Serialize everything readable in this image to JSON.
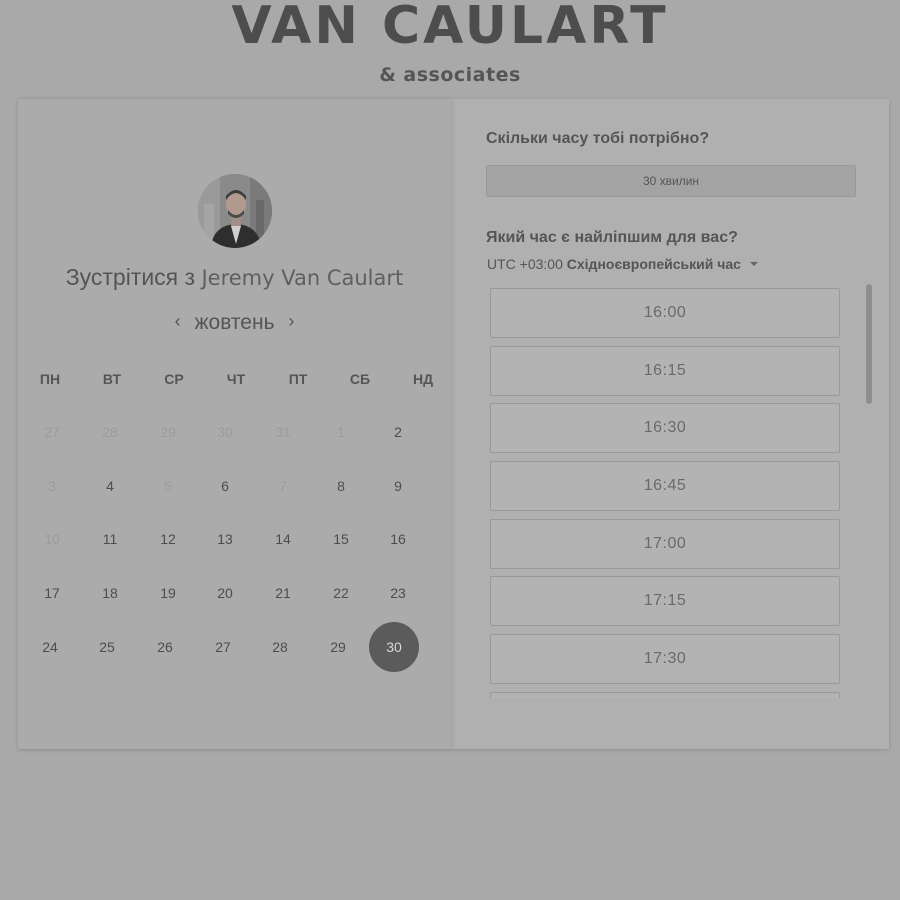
{
  "brand": {
    "name": "VAN CAULART",
    "subtitle": "& associates"
  },
  "calendar": {
    "title_prefix": "Зустрітися з",
    "host_name": "Jeremy Van Caulart",
    "month": "жовтень",
    "prev_icon": "‹",
    "next_icon": "›",
    "weekdays": [
      "ПН",
      "ВТ",
      "СР",
      "ЧТ",
      "ПТ",
      "СБ",
      "НД"
    ],
    "weeks": [
      [
        {
          "d": "27",
          "m": true
        },
        {
          "d": "28",
          "m": true
        },
        {
          "d": "29",
          "m": true
        },
        {
          "d": "30",
          "m": true
        },
        {
          "d": "31",
          "m": true
        },
        {
          "d": "1",
          "m": true
        },
        {
          "d": "2",
          "m": false
        }
      ],
      [
        {
          "d": "3",
          "m": true
        },
        {
          "d": "4",
          "m": false
        },
        {
          "d": "5",
          "m": true
        },
        {
          "d": "6",
          "m": false
        },
        {
          "d": "7",
          "m": true
        },
        {
          "d": "8",
          "m": false
        },
        {
          "d": "9",
          "m": false
        }
      ],
      [
        {
          "d": "10",
          "m": true
        },
        {
          "d": "11",
          "m": false
        },
        {
          "d": "12",
          "m": false
        },
        {
          "d": "13",
          "m": false
        },
        {
          "d": "14",
          "m": false
        },
        {
          "d": "15",
          "m": false
        },
        {
          "d": "16",
          "m": false
        }
      ],
      [
        {
          "d": "17",
          "m": false
        },
        {
          "d": "18",
          "m": false
        },
        {
          "d": "19",
          "m": false
        },
        {
          "d": "20",
          "m": false
        },
        {
          "d": "21",
          "m": false
        },
        {
          "d": "22",
          "m": false
        },
        {
          "d": "23",
          "m": false
        }
      ],
      [
        {
          "d": "24",
          "m": false
        },
        {
          "d": "25",
          "m": false
        },
        {
          "d": "26",
          "m": false
        },
        {
          "d": "27",
          "m": false
        },
        {
          "d": "28",
          "m": false
        },
        {
          "d": "29",
          "m": false
        },
        {
          "d": "30",
          "m": false
        }
      ]
    ],
    "selected_day": "30"
  },
  "booking": {
    "duration_question": "Скільки часу тобі потрібно?",
    "duration_value": "30 хвилин",
    "time_question": "Який час є найліпшим для вас?",
    "timezone_offset": "UTC +03:00",
    "timezone_name": "Східноєвропейський час",
    "slots": [
      "16:00",
      "16:15",
      "16:30",
      "16:45",
      "17:00",
      "17:15",
      "17:30",
      ""
    ]
  }
}
